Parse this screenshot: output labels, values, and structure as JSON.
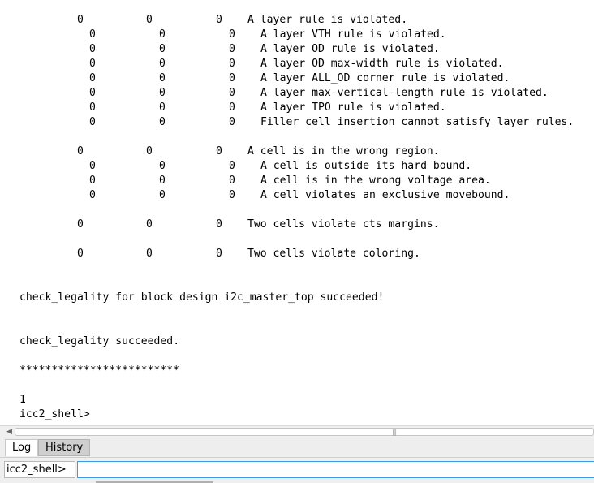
{
  "console": {
    "sections": [
      {
        "header": {
          "a": "0",
          "b": "0",
          "c": "0",
          "text": "A layer rule is violated."
        },
        "rows": [
          {
            "a": "0",
            "b": "0",
            "c": "0",
            "text": "A layer VTH rule is violated."
          },
          {
            "a": "0",
            "b": "0",
            "c": "0",
            "text": "A layer OD rule is violated."
          },
          {
            "a": "0",
            "b": "0",
            "c": "0",
            "text": "A layer OD max-width rule is violated."
          },
          {
            "a": "0",
            "b": "0",
            "c": "0",
            "text": "A layer ALL_OD corner rule is violated."
          },
          {
            "a": "0",
            "b": "0",
            "c": "0",
            "text": "A layer max-vertical-length rule is violated."
          },
          {
            "a": "0",
            "b": "0",
            "c": "0",
            "text": "A layer TPO rule is violated."
          },
          {
            "a": "0",
            "b": "0",
            "c": "0",
            "text": "Filler cell insertion cannot satisfy layer rules."
          }
        ]
      },
      {
        "header": {
          "a": "0",
          "b": "0",
          "c": "0",
          "text": "A cell is in the wrong region."
        },
        "rows": [
          {
            "a": "0",
            "b": "0",
            "c": "0",
            "text": "A cell is outside its hard bound."
          },
          {
            "a": "0",
            "b": "0",
            "c": "0",
            "text": "A cell is in the wrong voltage area."
          },
          {
            "a": "0",
            "b": "0",
            "c": "0",
            "text": "A cell violates an exclusive movebound."
          }
        ]
      },
      {
        "header": {
          "a": "0",
          "b": "0",
          "c": "0",
          "text": "Two cells violate cts margins."
        },
        "rows": []
      },
      {
        "header": {
          "a": "0",
          "b": "0",
          "c": "0",
          "text": "Two cells violate coloring."
        },
        "rows": []
      }
    ],
    "block_msg": "check_legality for block design i2c_master_top succeeded!",
    "success_msg": "check_legality succeeded.",
    "stars": "*************************",
    "result": "1",
    "prompt": "icc2_shell>"
  },
  "scrollbar": {
    "left_arrow": "◀",
    "grip": "|||"
  },
  "tabs": {
    "log": "Log",
    "history": "History"
  },
  "cmd": {
    "prompt_label": "icc2_shell>",
    "value": ""
  }
}
